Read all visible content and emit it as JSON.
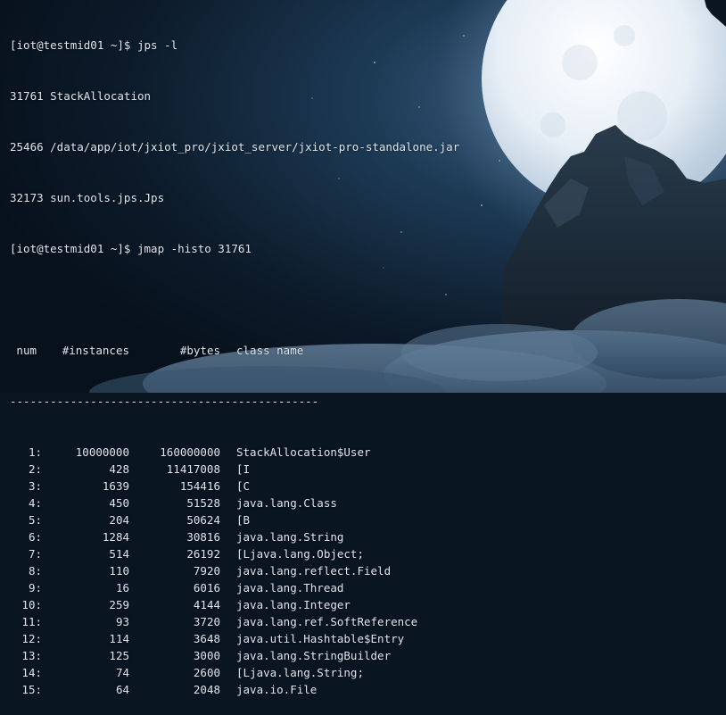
{
  "terminal": {
    "prompt_1": "[iot@testmid01 ~]$ jps -l",
    "jps_lines": [
      "31761 StackAllocation",
      "25466 /data/app/iot/jxiot_pro/jxiot_server/jxiot-pro-standalone.jar",
      "32173 sun.tools.jps.Jps"
    ],
    "prompt_2": "[iot@testmid01 ~]$ jmap -histo 31761",
    "header": {
      "num": "num",
      "instances": "#instances",
      "bytes": "#bytes",
      "class_name": "class name"
    },
    "separator": "----------------------------------------------",
    "rows": [
      {
        "num": "1:",
        "instances": "10000000",
        "bytes": "160000000",
        "class_name": "StackAllocation$User"
      },
      {
        "num": "2:",
        "instances": "428",
        "bytes": "11417008",
        "class_name": "[I"
      },
      {
        "num": "3:",
        "instances": "1639",
        "bytes": "154416",
        "class_name": "[C"
      },
      {
        "num": "4:",
        "instances": "450",
        "bytes": "51528",
        "class_name": "java.lang.Class"
      },
      {
        "num": "5:",
        "instances": "204",
        "bytes": "50624",
        "class_name": "[B"
      },
      {
        "num": "6:",
        "instances": "1284",
        "bytes": "30816",
        "class_name": "java.lang.String"
      },
      {
        "num": "7:",
        "instances": "514",
        "bytes": "26192",
        "class_name": "[Ljava.lang.Object;"
      },
      {
        "num": "8:",
        "instances": "110",
        "bytes": "7920",
        "class_name": "java.lang.reflect.Field"
      },
      {
        "num": "9:",
        "instances": "16",
        "bytes": "6016",
        "class_name": "java.lang.Thread"
      },
      {
        "num": "10:",
        "instances": "259",
        "bytes": "4144",
        "class_name": "java.lang.Integer"
      },
      {
        "num": "11:",
        "instances": "93",
        "bytes": "3720",
        "class_name": "java.lang.ref.SoftReference"
      },
      {
        "num": "12:",
        "instances": "114",
        "bytes": "3648",
        "class_name": "java.util.Hashtable$Entry"
      },
      {
        "num": "13:",
        "instances": "125",
        "bytes": "3000",
        "class_name": "java.lang.StringBuilder"
      },
      {
        "num": "14:",
        "instances": "74",
        "bytes": "2600",
        "class_name": "[Ljava.lang.String;"
      },
      {
        "num": "15:",
        "instances": "64",
        "bytes": "2048",
        "class_name": "java.io.File"
      }
    ]
  },
  "colors": {
    "text": "#dfe6ee",
    "sky_dark": "#07111c",
    "sky_mid": "#1d3a55",
    "moon": "#eef4fa",
    "mountain": "#14222f",
    "clouds": "#5d7893"
  }
}
